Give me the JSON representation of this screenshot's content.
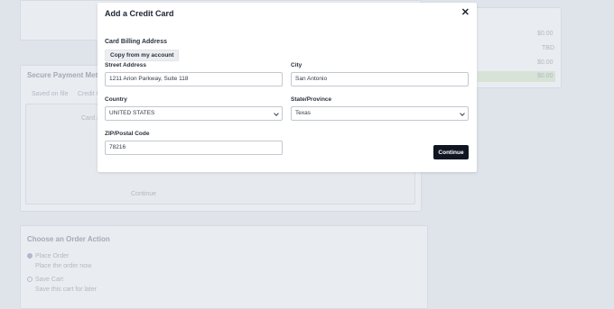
{
  "modal": {
    "title": "Add a Credit Card",
    "close_glyph": "✕",
    "section_title": "Card Billing Address",
    "copy_button": "Copy from my account",
    "continue_button": "Continue"
  },
  "fields": {
    "street": {
      "label": "Street Address",
      "value": "1211 Arion Parkway, Suite 118"
    },
    "city": {
      "label": "City",
      "value": "San Antonio"
    },
    "country": {
      "label": "Country",
      "value": "UNITED STATES"
    },
    "state": {
      "label": "State/Province",
      "value": "Texas"
    },
    "zip": {
      "label": "ZIP/Postal Code",
      "value": "78216"
    }
  },
  "background": {
    "payment_heading": "Secure Payment Meth",
    "tab_saved": "Saved on file",
    "tab_credit": "Credit C",
    "card_label": "Card #",
    "order_action_heading": "Choose an Order Action",
    "place_order": "Place Order",
    "place_order_sub": "Place the order now",
    "save_cart": "Save Cart",
    "save_cart_sub": "Save this cart for later",
    "prices": [
      "$0.00",
      "TBD",
      "$0.00",
      "$0.00"
    ],
    "footer_text": "Continue"
  }
}
